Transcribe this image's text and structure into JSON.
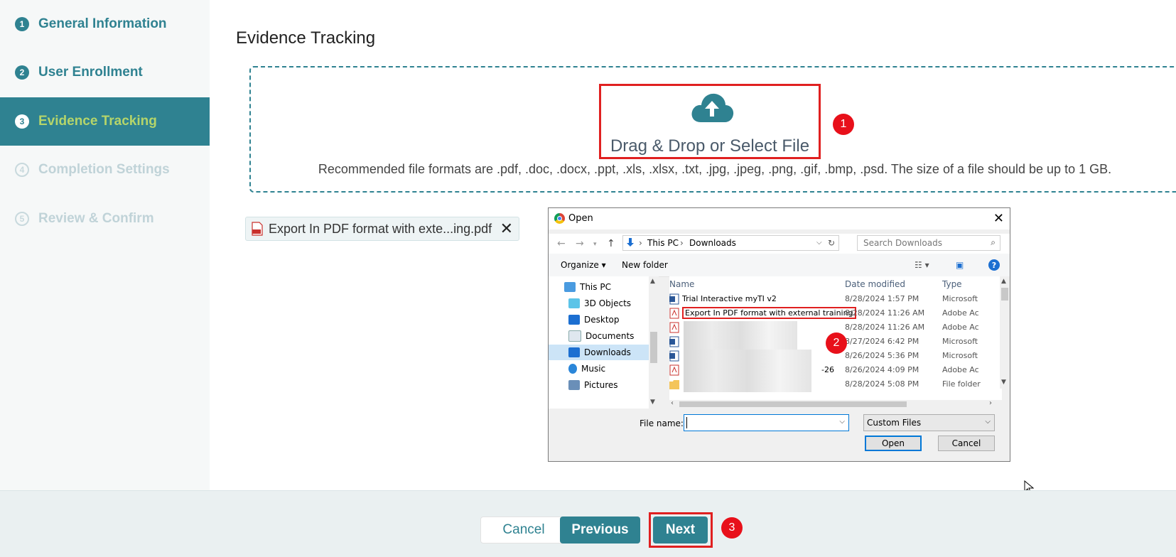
{
  "sidebar": {
    "steps": [
      {
        "num": "1",
        "label": "General Information",
        "state": "done"
      },
      {
        "num": "2",
        "label": "User Enrollment",
        "state": "done"
      },
      {
        "num": "3",
        "label": "Evidence Tracking",
        "state": "active"
      },
      {
        "num": "4",
        "label": "Completion Settings",
        "state": "todo"
      },
      {
        "num": "5",
        "label": "Review & Confirm",
        "state": "todo"
      }
    ]
  },
  "main": {
    "title": "Evidence Tracking",
    "upload": {
      "icon": "cloud-upload-icon",
      "label": "Drag & Drop or Select File",
      "formats_note": "Recommended file formats are .pdf, .doc, .docx, .ppt, .xls, .xlsx, .txt, .jpg, .jpeg, .png, .gif, .bmp, .psd. The size of a file should be up to 1 GB."
    },
    "attached_file": {
      "name": "Export In PDF format with exte...ing.pdf",
      "remove_icon": "close-icon"
    }
  },
  "markers": [
    "1",
    "2",
    "3"
  ],
  "dialog": {
    "title": "Open",
    "path": [
      "This PC",
      "Downloads"
    ],
    "search_placeholder": "Search Downloads",
    "organize_label": "Organize ▾",
    "new_folder_label": "New folder",
    "help_label": "?",
    "tree": [
      "This PC",
      "3D Objects",
      "Desktop",
      "Documents",
      "Downloads",
      "Music",
      "Pictures"
    ],
    "columns": {
      "name": "Name",
      "date": "Date modified",
      "type": "Type"
    },
    "files": [
      {
        "name": "Trial Interactive myTI v2",
        "date": "8/28/2024 1:57 PM",
        "type": "Microsoft",
        "kind": "word"
      },
      {
        "name": "Export In PDF format with external training",
        "date": "8/28/2024 11:26 AM",
        "type": "Adobe Ac",
        "kind": "pdf"
      },
      {
        "name": "",
        "date": "8/28/2024 11:26 AM",
        "type": "Adobe Ac",
        "kind": "pdf"
      },
      {
        "name": "",
        "date": "8/27/2024 6:42 PM",
        "type": "Microsoft",
        "kind": "word"
      },
      {
        "name": "",
        "date": "8/26/2024 5:36 PM",
        "type": "Microsoft",
        "kind": "word"
      },
      {
        "name": "-26",
        "date": "8/26/2024 4:09 PM",
        "type": "Adobe Ac",
        "kind": "pdf"
      },
      {
        "name": "",
        "date": "8/28/2024 5:08 PM",
        "type": "File folder",
        "kind": "folder"
      }
    ],
    "file_name_label": "File name:",
    "file_name_value": "",
    "file_type_value": "Custom Files",
    "open_label": "Open",
    "cancel_label": "Cancel"
  },
  "footer": {
    "cancel_label": "Cancel",
    "previous_label": "Previous",
    "next_label": "Next"
  },
  "colors": {
    "primary": "#2f8291",
    "active_text": "#b5d56a",
    "highlight": "#e02020",
    "marker": "#e8101a"
  }
}
